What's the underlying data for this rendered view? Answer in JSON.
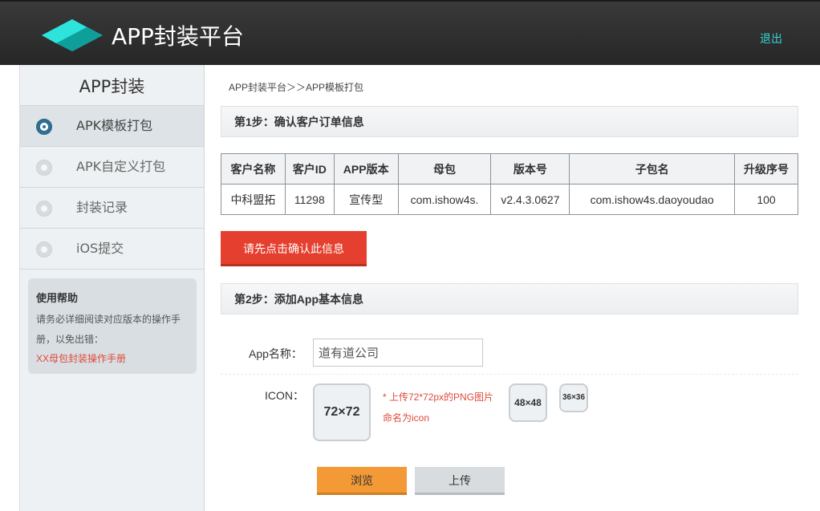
{
  "header": {
    "title": "APP封装平台",
    "logout_label": "退出"
  },
  "sidebar": {
    "title": "APP封装",
    "items": [
      {
        "label": "APK模板打包",
        "active": true
      },
      {
        "label": "APK自定义打包",
        "active": false
      },
      {
        "label": "封装记录",
        "active": false
      },
      {
        "label": "iOS提交",
        "active": false
      }
    ],
    "help": {
      "title": "使用帮助",
      "text_line1": "请务必详细阅读对应版本的操作手",
      "text_line2": "册，以免出错：",
      "link": "XX母包封装操作手册"
    }
  },
  "breadcrumb": "APP封装平台＞＞APP模板打包",
  "step1": {
    "title": "第1步：确认客户订单信息",
    "table": {
      "headers": [
        "客户名称",
        "客户ID",
        "APP版本",
        "母包",
        "版本号",
        "子包名",
        "升级序号"
      ],
      "rows": [
        [
          "中科盟拓",
          "11298",
          "宣传型",
          "com.ishow4s.",
          "v2.4.3.0627",
          "com.ishow4s.daoyoudao",
          "100"
        ]
      ]
    },
    "confirm_label": "请先点击确认此信息"
  },
  "step2": {
    "title": "第2步：添加App基本信息",
    "app_name_label": "App名称：",
    "app_name_value": "道有道公司",
    "icon_label": "ICON：",
    "icon_72": "72×72",
    "icon_48": "48×48",
    "icon_36": "36×36",
    "hint_line1": "* 上传72*72px的PNG图片",
    "hint_line2": "命名为icon",
    "browse_label": "浏览",
    "upload_label": "上传"
  },
  "colors": {
    "accent_teal": "#35d4d4",
    "confirm_red": "#e5402f",
    "browse_orange": "#f39a37"
  }
}
